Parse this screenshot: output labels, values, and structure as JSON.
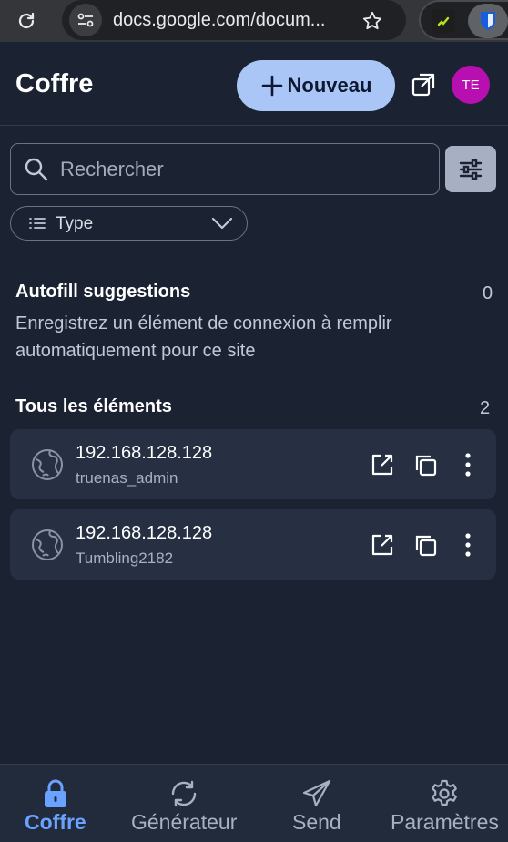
{
  "browser": {
    "url": "docs.google.com/docum...",
    "icons": [
      "reload-icon",
      "site-info-icon",
      "bookmark-star-icon",
      "extension-icon",
      "bitwarden-shield-icon"
    ]
  },
  "header": {
    "title": "Coffre",
    "new_label": "Nouveau",
    "avatar_initials": "TE",
    "avatar_color": "#b80fb0",
    "accent_color": "#a9c6f6"
  },
  "search": {
    "placeholder": "Rechercher"
  },
  "filter": {
    "type_label": "Type"
  },
  "autofill": {
    "title": "Autofill suggestions",
    "count": "0",
    "description": "Enregistrez un élément de connexion à remplir automatiquement pour ce site"
  },
  "all_items": {
    "title": "Tous les éléments",
    "count": "2",
    "items": [
      {
        "title": "192.168.128.128",
        "subtitle": "truenas_admin"
      },
      {
        "title": "192.168.128.128",
        "subtitle": "Tumbling2182"
      }
    ]
  },
  "nav": {
    "active_color": "#6aa2ff",
    "items": [
      {
        "label": "Coffre",
        "icon": "lock-icon",
        "active": true
      },
      {
        "label": "Générateur",
        "icon": "refresh-icon",
        "active": false
      },
      {
        "label": "Send",
        "icon": "paper-plane-icon",
        "active": false
      },
      {
        "label": "Paramètres",
        "icon": "gear-icon",
        "active": false
      }
    ]
  }
}
